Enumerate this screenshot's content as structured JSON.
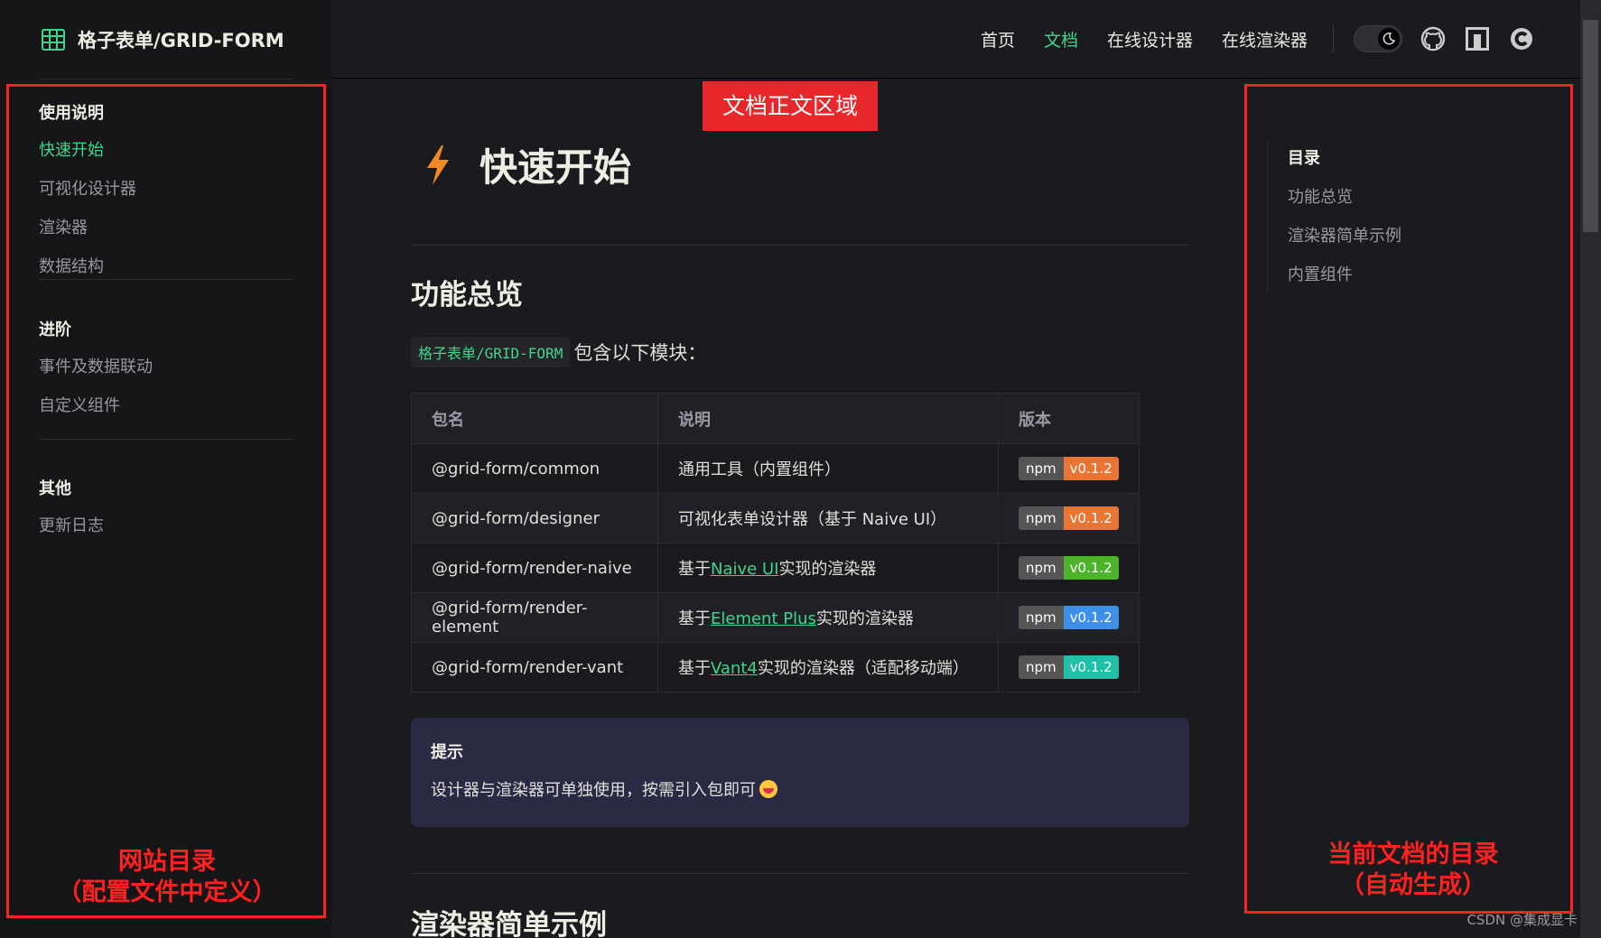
{
  "brand": {
    "title": "格子表单/GRID-FORM",
    "icon": "table-grid-icon"
  },
  "nav": {
    "links": [
      {
        "label": "首页",
        "active": false
      },
      {
        "label": "文档",
        "active": true
      },
      {
        "label": "在线设计器",
        "active": false
      },
      {
        "label": "在线渲染器",
        "active": false
      }
    ],
    "theme_icon": "moon-icon",
    "icons": [
      "github-icon",
      "csdn-icon-square",
      "csdn-icon-c"
    ]
  },
  "sidebar": {
    "groups": [
      {
        "title": "使用说明",
        "items": [
          "快速开始",
          "可视化设计器",
          "渲染器",
          "数据结构"
        ],
        "active_index": 0
      },
      {
        "title": "进阶",
        "items": [
          "事件及数据联动",
          "自定义组件"
        ]
      },
      {
        "title": "其他",
        "items": [
          "更新日志"
        ]
      }
    ]
  },
  "annotations": {
    "content_tag": "文档正文区域",
    "left_label_line1": "网站目录",
    "left_label_line2": "（配置文件中定义）",
    "right_label_line1": "当前文档的目录",
    "right_label_line2": "（自动生成）"
  },
  "content": {
    "page_title": "快速开始",
    "h2_overview": "功能总览",
    "intro_code": "格子表单/GRID-FORM",
    "intro_text": "包含以下模块：",
    "table": {
      "headers": [
        "包名",
        "说明",
        "版本"
      ],
      "rows": [
        {
          "name": "@grid-form/common",
          "desc_before": "通用工具（内置组件）",
          "link": "",
          "desc_after": "",
          "badge_left": "npm",
          "badge_right": "v0.1.2",
          "badge_color": "#e87534"
        },
        {
          "name": "@grid-form/designer",
          "desc_before": "可视化表单设计器（基于 Naive UI）",
          "link": "",
          "desc_after": "",
          "badge_left": "npm",
          "badge_right": "v0.1.2",
          "badge_color": "#e87534"
        },
        {
          "name": "@grid-form/render-naive",
          "desc_before": "基于",
          "link": "Naive UI",
          "desc_after": "实现的渲染器",
          "badge_left": "npm",
          "badge_right": "v0.1.2",
          "badge_color": "#4cb32b"
        },
        {
          "name": "@grid-form/render-element",
          "desc_before": "基于",
          "link": "Element Plus",
          "desc_after": "实现的渲染器",
          "badge_left": "npm",
          "badge_right": "v0.1.2",
          "badge_color": "#3d8fe8"
        },
        {
          "name": "@grid-form/render-vant",
          "desc_before": "基于",
          "link": "Vant4",
          "desc_after": "实现的渲染器（适配移动端）",
          "badge_left": "npm",
          "badge_right": "v0.1.2",
          "badge_color": "#20c0a8"
        }
      ]
    },
    "tip": {
      "title": "提示",
      "text": "设计器与渲染器可单独使用，按需引入包即可",
      "emoji": "grinning-face-emoji"
    },
    "h2_next": "渲染器简单示例"
  },
  "outline": {
    "title": "目录",
    "items": [
      "功能总览",
      "渲染器简单示例",
      "内置组件"
    ]
  },
  "watermark": "CSDN @集成显卡"
}
